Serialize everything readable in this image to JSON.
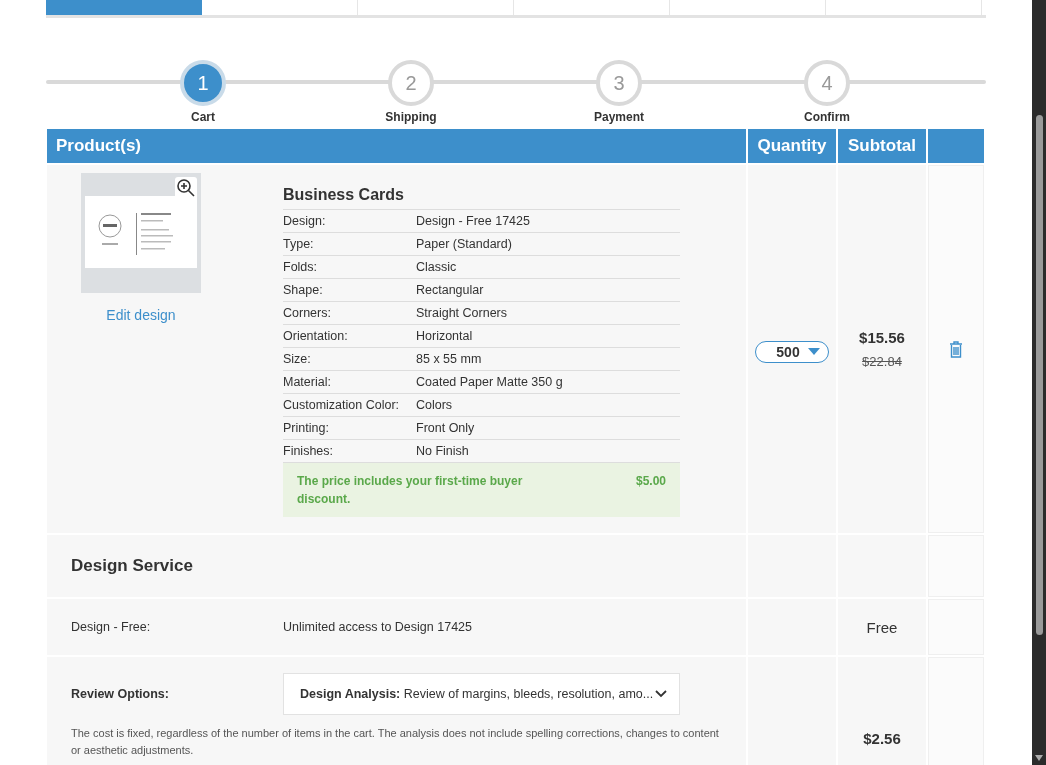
{
  "top_tabs": [
    {
      "selected": true
    },
    {
      "selected": false
    },
    {
      "selected": false
    },
    {
      "selected": false
    },
    {
      "selected": false
    },
    {
      "selected": false
    }
  ],
  "steps": [
    {
      "number": "1",
      "label": "Cart",
      "selected": true
    },
    {
      "number": "2",
      "label": "Shipping",
      "selected": false
    },
    {
      "number": "3",
      "label": "Payment",
      "selected": false
    },
    {
      "number": "4",
      "label": "Confirm",
      "selected": false
    }
  ],
  "cart": {
    "columns": [
      "Product(s)",
      "Quantity",
      "Subtotal"
    ],
    "item": {
      "title": "Business Cards",
      "edit_link": "Edit design",
      "specs": [
        {
          "label": "Design:",
          "value": "Design - Free 17425"
        },
        {
          "label": "Type:",
          "value": "Paper (Standard)"
        },
        {
          "label": "Folds:",
          "value": "Classic"
        },
        {
          "label": "Shape:",
          "value": "Rectangular"
        },
        {
          "label": "Corners:",
          "value": "Straight Corners"
        },
        {
          "label": "Orientation:",
          "value": "Horizontal"
        },
        {
          "label": "Size:",
          "value": "85 x 55 mm"
        },
        {
          "label": "Material:",
          "value": "Coated Paper Matte 350 g"
        },
        {
          "label": "Customization Color:",
          "value": "Colors"
        },
        {
          "label": "Printing:",
          "value": "Front Only"
        },
        {
          "label": "Finishes:",
          "value": "No Finish"
        }
      ],
      "discount": {
        "text": "The price includes your first-time buyer discount.",
        "amount": "$5.00"
      },
      "quantity": "500",
      "price": "$15.56",
      "old_price": "$22.84"
    },
    "design_service": {
      "title": "Design Service",
      "rows": [
        {
          "kind": "text",
          "label": "Design - Free:",
          "value": "Unlimited access to Design 17425",
          "price": "Free"
        },
        {
          "kind": "select",
          "label": "Review Options:",
          "value": "**Design Analysis:** Review of margins, bleeds, resolution, amo...",
          "note": "The cost is fixed, regardless of the number of items in the cart. The analysis does not include spelling corrections, changes to content or aesthetic adjustments.",
          "price": "$2.56"
        }
      ]
    }
  }
}
